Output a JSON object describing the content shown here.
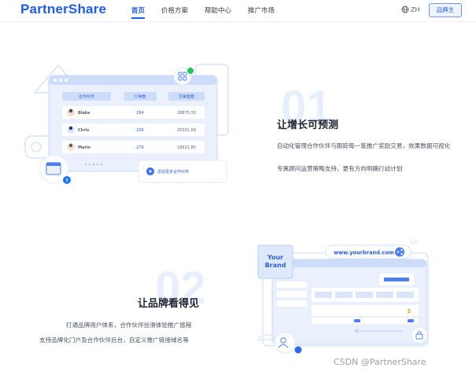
{
  "header": {
    "logo": "PartnerShare",
    "nav": [
      "首页",
      "价格方案",
      "帮助中心",
      "推广市场"
    ],
    "active_nav": 0,
    "lang": "ZH",
    "brand_button": "品牌主"
  },
  "section1": {
    "number": "01",
    "title": "让增长可预测",
    "desc1": "自动化管理合作伙伴与跟踪每一笔推广奖励交易，效果数据可视化",
    "desc2": "专属顾问运营策略支持，更有方向明确行动计划",
    "table": {
      "headers": [
        "合作伙伴",
        "订单数",
        "交易金额"
      ],
      "rows": [
        {
          "name": "Blake",
          "orders": "264",
          "amount": "28875.30"
        },
        {
          "name": "Chris",
          "orders": "206",
          "amount": "20301.09"
        },
        {
          "name": "Mario",
          "orders": "276",
          "amount": "18921.85"
        }
      ]
    },
    "add_partner": "添加更多合作伙伴"
  },
  "section2": {
    "number": "02",
    "title": "让品牌看得见",
    "desc1": "打通品牌用户体系，合作伙伴丝滑体验推广旅程",
    "desc2": "支持品牌化门户及合作伙伴后台，自定义推广链接域名等",
    "brand_card_line1": "Your",
    "brand_card_line2": "Brand",
    "url": "www.yourbrand.com",
    "dollar": "$"
  },
  "watermark": "CSDN @PartnerShare",
  "colors": {
    "accent": "#1d5bf0",
    "light": "#e7effd"
  }
}
